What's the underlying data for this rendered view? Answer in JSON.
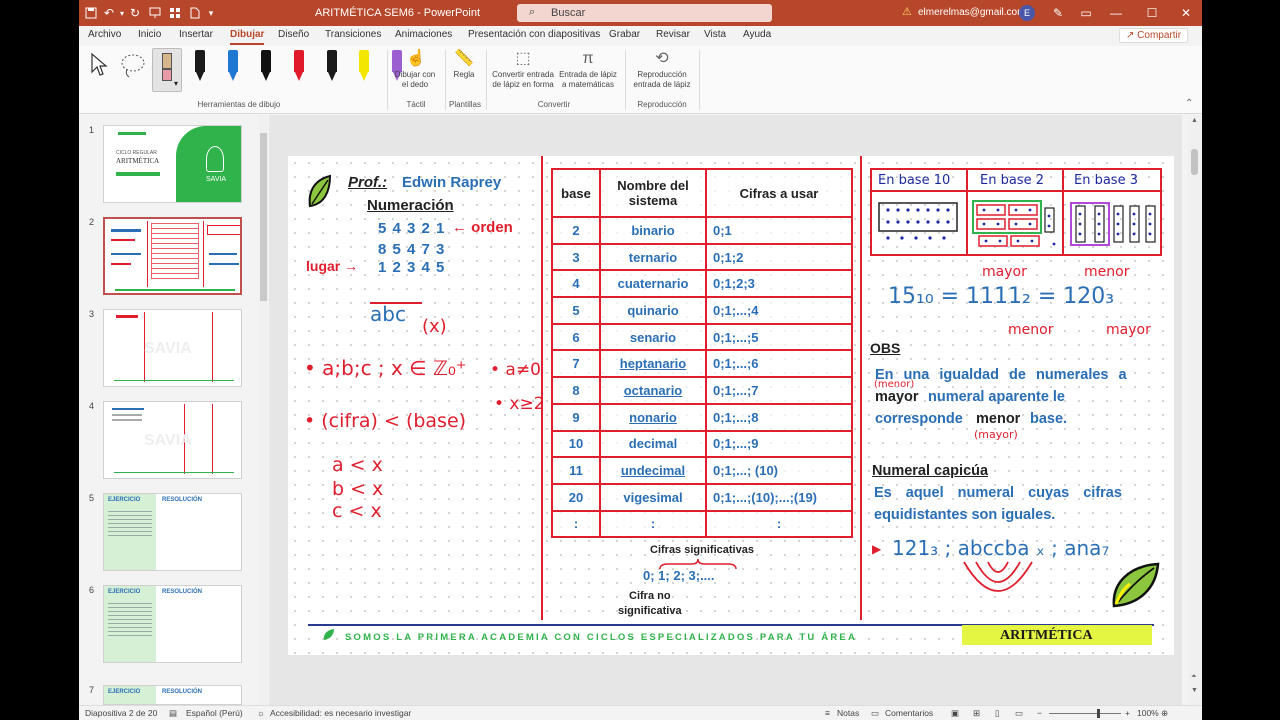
{
  "window": {
    "title": "ARITMÉTICA SEM6  -  PowerPoint",
    "search_placeholder": "Buscar",
    "account_email": "elmerelmas@gmail.com",
    "account_initial": "E"
  },
  "tabs": [
    "Archivo",
    "Inicio",
    "Insertar",
    "Dibujar",
    "Diseño",
    "Transiciones",
    "Animaciones",
    "Presentación con diapositivas",
    "Grabar",
    "Revisar",
    "Vista",
    "Ayuda"
  ],
  "active_tab": "Dibujar",
  "share_label": "Compartir",
  "ribbon": {
    "tools_group": "Herramientas de dibujo",
    "pen_colors": [
      "#1a1a1a",
      "#1e78d2",
      "#111111",
      "#e0192b",
      "#1a1a1a",
      "#f3e600",
      "#9b5fd1"
    ],
    "btn_finger": "Dibujar con el dedo",
    "btn_ruler": "Regla",
    "btn_ink_shape": "Convertir entrada de lápiz en forma",
    "btn_ink_math": "Entrada de lápiz a matemáticas",
    "btn_replay": "Reproducción entrada de lápiz",
    "group_touch": "Táctil",
    "group_templates": "Plantillas",
    "group_convert": "Convertir",
    "group_replay": "Reproducción"
  },
  "thumbs": [
    {
      "num": "1",
      "top": "CICLO REGULAR",
      "title": "ARITMÉTICA",
      "brand": "SAVIA"
    },
    {
      "num": "2"
    },
    {
      "num": "3",
      "brand": "SAVIA"
    },
    {
      "num": "4",
      "brand": "SAVIA"
    },
    {
      "num": "5",
      "left": "EJERCICIO",
      "right": "RESOLUCIÓN"
    },
    {
      "num": "6",
      "left": "EJERCICIO",
      "right": "RESOLUCIÓN"
    },
    {
      "num": "7",
      "left": "EJERCICIO",
      "right": "RESOLUCIÓN"
    }
  ],
  "slide": {
    "prof_label": "Prof.:",
    "prof_name": "Edwin Raprey",
    "topic": "Numeración",
    "num_row1": "5 4 3 2 1",
    "orden": "← orden",
    "num_row2": "8 5 4 7 3",
    "lugar": "lugar →",
    "num_row3": "1 2 3 4 5",
    "ink_abc": "abc",
    "ink_x": "(x)",
    "ink_set": "• a;b;c ; x ∈ ℤ₀⁺",
    "ink_a_ne_0": "• a≠0",
    "ink_x_ge_2": "• x≥2",
    "ink_cifra": "• (cifra) < (base)",
    "ink_a_lt_x": "a  <  x",
    "ink_b_lt_x": "b  <  x",
    "ink_c_lt_x": "c  <  x",
    "table": {
      "headers": [
        "base",
        "Nombre del sistema",
        "Cifras a usar"
      ],
      "rows": [
        [
          "2",
          "binario",
          "0;1"
        ],
        [
          "3",
          "ternario",
          "0;1;2"
        ],
        [
          "4",
          "cuaternario",
          "0;1;2;3"
        ],
        [
          "5",
          "quinario",
          "0;1;...;4"
        ],
        [
          "6",
          "senario",
          "0;1;...;5"
        ],
        [
          "7",
          "heptanario",
          "0;1;...;6"
        ],
        [
          "8",
          "octanario",
          "0;1;...;7"
        ],
        [
          "9",
          "nonario",
          "0;1;...;8"
        ],
        [
          "10",
          "decimal",
          "0;1;...;9"
        ],
        [
          "11",
          "undecimal",
          "0;1;...; (10)"
        ],
        [
          "20",
          "vigesimal",
          "0;1;...;(10);...;(19)"
        ],
        [
          ":",
          ":",
          ":"
        ]
      ]
    },
    "cifras_sig": "Cifras significativas",
    "digits": "0; 1; 2; 3;....",
    "cifra_no": "Cifra no",
    "significativa": "significativa",
    "bases": [
      "En base 10",
      "En base 2",
      "En base 3"
    ],
    "mayor": "mayor",
    "menor": "menor",
    "equation": "15₁₀ = 1111₂ = 120₃",
    "obs": "OBS",
    "obs_line1": "En una igualdad de numerales a",
    "obs_w_mayor": "mayor",
    "obs_w_numeral": "numeral aparente le",
    "obs_w_corresponde": "corresponde",
    "obs_w_menor": "menor",
    "obs_w_base": "base.",
    "note_menor": "(menor)",
    "note_mayor": "(mayor)",
    "capicua_title": "Numeral capicúa",
    "capicua_line1": "Es aquel numeral cuyas cifras",
    "capicua_line2": "equidistantes son iguales.",
    "capicua_examples": "121₃ ; abccba ₓ ; ana₇",
    "footer": "SOMOS LA PRIMERA ACADEMIA CON CICLOS ESPECIALIZADOS PARA TU ÁREA",
    "footer_badge": "ARITMÉTICA"
  },
  "status": {
    "slide": "Diapositiva 2 de 20",
    "lang": "Español (Perú)",
    "access": "Accesibilidad: es necesario investigar",
    "notes": "Notas",
    "comments": "Comentarios",
    "zoom": "100%"
  }
}
